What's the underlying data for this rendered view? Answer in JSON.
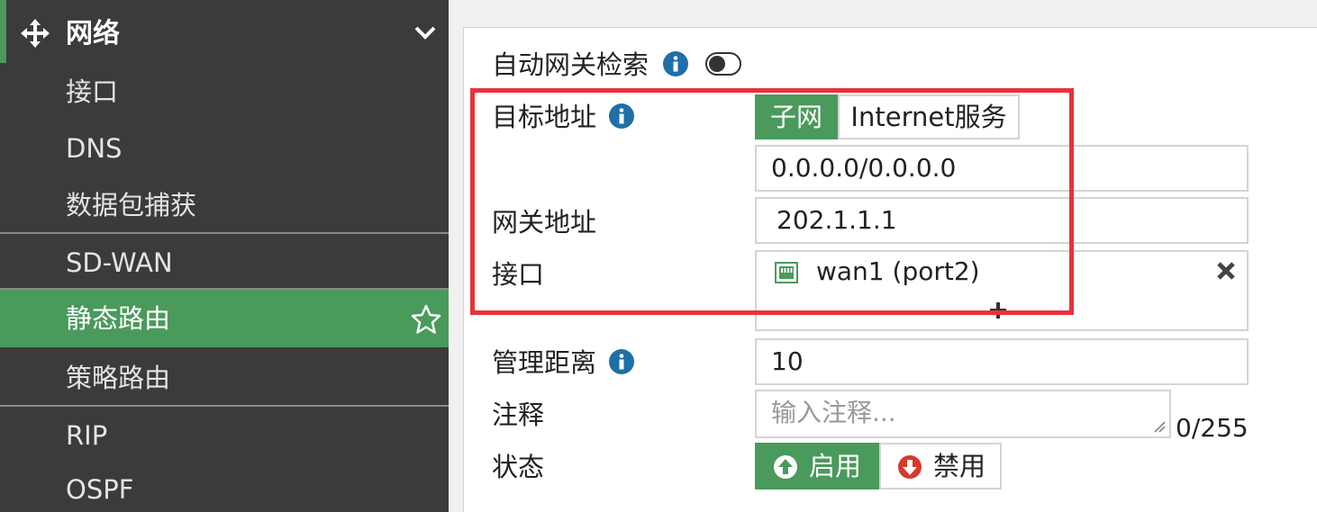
{
  "sidebar": {
    "section_title": "网络",
    "items": [
      {
        "label": "接口"
      },
      {
        "label": "DNS"
      },
      {
        "label": "数据包捕获"
      },
      {
        "label": "SD-WAN"
      },
      {
        "label": "静态路由"
      },
      {
        "label": "策略路由"
      },
      {
        "label": "RIP"
      },
      {
        "label": "OSPF"
      }
    ]
  },
  "form": {
    "auto_gateway": {
      "label": "自动网关检索",
      "enabled": false
    },
    "destination": {
      "label": "目标地址",
      "options": [
        "子网",
        "Internet服务"
      ],
      "selected": "子网",
      "value": "0.0.0.0/0.0.0.0"
    },
    "gateway": {
      "label": "网关地址",
      "value": "202.1.1.1"
    },
    "interface": {
      "label": "接口",
      "value": "wan1 (port2)"
    },
    "admin_distance": {
      "label": "管理距离",
      "value": "10"
    },
    "comment": {
      "label": "注释",
      "placeholder": "输入注释...",
      "counter": "0/255"
    },
    "status": {
      "label": "状态",
      "enable_label": "启用",
      "disable_label": "禁用",
      "selected": "启用"
    }
  },
  "colors": {
    "accent_green": "#4a9a5c",
    "info_blue": "#1f6fa8",
    "disable_red": "#d63a2a",
    "highlight_red": "#e8323c",
    "sidebar_bg": "#3b3b3b"
  }
}
